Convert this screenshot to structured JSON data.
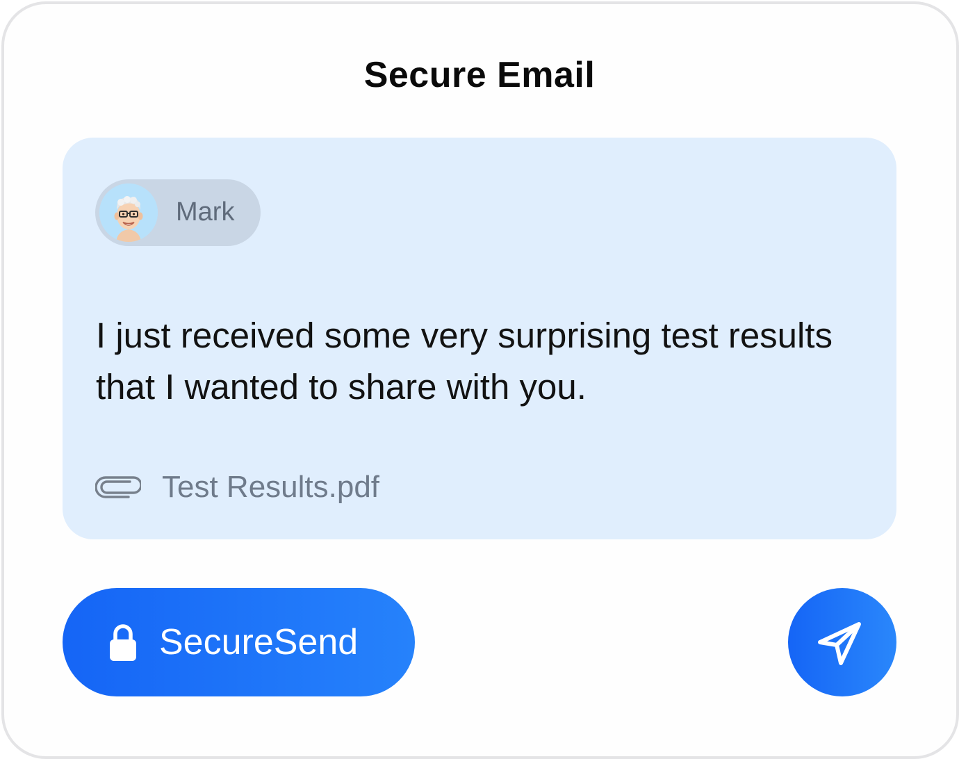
{
  "title": "Secure Email",
  "sender": {
    "name": "Mark",
    "avatar_icon": "memoji-avatar"
  },
  "message": {
    "body": "I just received some very surprising test results that I wanted to share with you."
  },
  "attachment": {
    "icon": "paperclip-icon",
    "filename": "Test Results.pdf"
  },
  "actions": {
    "secure_send_label": "SecureSend",
    "secure_send_icon": "lock-icon",
    "send_icon": "paper-plane-icon"
  },
  "colors": {
    "panel_bg": "#e0eefd",
    "accent_start": "#1565f6",
    "accent_end": "#2682fb",
    "muted_text": "#6f7b8b"
  }
}
